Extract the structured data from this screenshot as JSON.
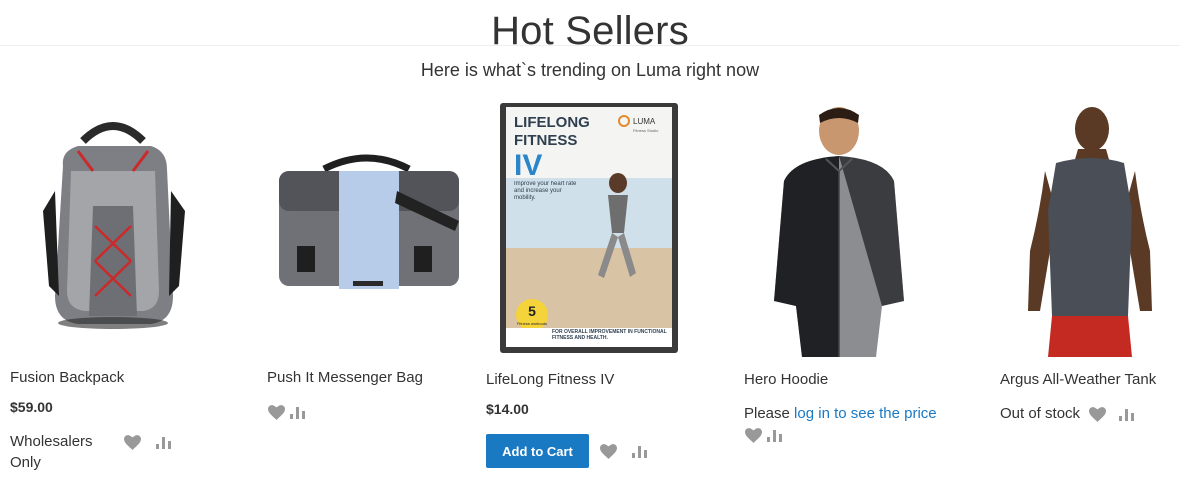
{
  "section": {
    "title": "Hot Sellers",
    "subtitle": "Here is what`s trending on Luma right now"
  },
  "products": [
    {
      "name": "Fusion Backpack",
      "price": "$59.00",
      "note": "Wholesalers Only"
    },
    {
      "name": "Push It Messenger Bag"
    },
    {
      "name": "LifeLong Fitness IV",
      "price": "$14.00",
      "add_to_cart": "Add to Cart",
      "cover": {
        "title_line1": "LIFELONG",
        "title_line2": "FITNESS",
        "title_line3": "IV",
        "brand": "LUMA",
        "brand_sub": "Fitness Studio",
        "blurb": "Improve your heart rate and increase your mobility.",
        "badge_number": "5",
        "badge_text": "Fitness workouts",
        "footer": "FOR OVERALL IMPROVEMENT IN FUNCTIONAL FITNESS AND HEALTH."
      }
    },
    {
      "name": "Hero Hoodie",
      "price_prefix": "Please ",
      "price_link": "log in to see the price"
    },
    {
      "name": "Argus All-Weather Tank",
      "stock": "Out of stock"
    }
  ],
  "icons": {
    "wishlist": "heart-icon",
    "compare": "compare-bars-icon"
  },
  "colors": {
    "accent": "#1979c3",
    "icon_gray": "#999999",
    "text": "#333333"
  }
}
